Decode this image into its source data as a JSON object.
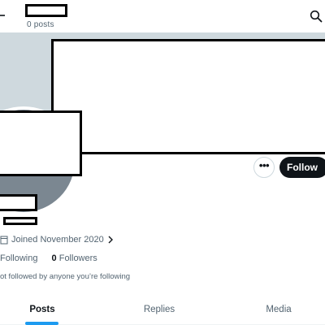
{
  "header": {
    "posts_count": "0 posts",
    "back_icon": "arrow-left-icon",
    "search_icon": "search-icon"
  },
  "profile": {
    "more_label": "•••",
    "follow_label": "Follow",
    "joined_text": "Joined November 2020",
    "following_count": "",
    "following_label": "Following",
    "followers_count": "0",
    "followers_label": "Followers",
    "followed_note": "ot followed by anyone you’re following"
  },
  "tabs": [
    {
      "label": "Posts",
      "active": true
    },
    {
      "label": "Replies",
      "active": false
    },
    {
      "label": "Media",
      "active": false
    }
  ],
  "colors": {
    "banner": "#cfd9de",
    "avatar": "#7b8791",
    "follow_button": "#0f1419",
    "accent": "#1d9bf0",
    "secondary_text": "#536471"
  }
}
